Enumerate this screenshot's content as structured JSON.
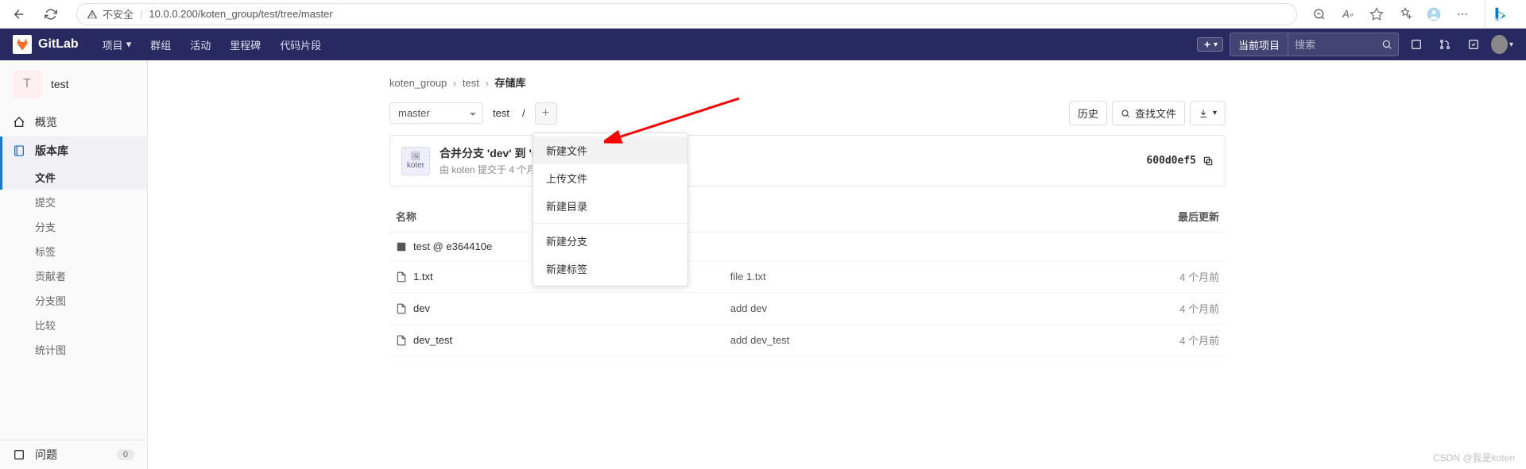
{
  "browser": {
    "insecure_label": "不安全",
    "url": "10.0.0.200/koten_group/test/tree/master"
  },
  "header": {
    "logo_text": "GitLab",
    "nav": [
      "项目",
      "群组",
      "活动",
      "里程碑",
      "代码片段"
    ],
    "search_scope": "当前项目",
    "search_placeholder": "搜索"
  },
  "sidebar": {
    "project_initial": "T",
    "project_name": "test",
    "items": [
      {
        "icon": "home",
        "label": "概览"
      },
      {
        "icon": "repo",
        "label": "版本库",
        "active": true
      }
    ],
    "repo_sub": [
      "文件",
      "提交",
      "分支",
      "标签",
      "贡献者",
      "分支图",
      "比较",
      "统计图"
    ],
    "repo_sub_active": "文件",
    "issues_label": "问题",
    "issues_count": "0"
  },
  "breadcrumb": {
    "group": "koten_group",
    "project": "test",
    "page": "存储库"
  },
  "toolbar": {
    "branch": "master",
    "path": "test",
    "history": "历史",
    "find_file": "查找文件"
  },
  "commit": {
    "avatar_alt": "koter",
    "title": "合并分支 'dev' 到 'master'",
    "meta": "由 koten 提交于 4 个月前",
    "sha": "600d0ef5"
  },
  "table": {
    "headers": [
      "名称",
      "",
      "最后更新"
    ],
    "rows": [
      {
        "icon": "submodule",
        "name": "test @ e364410e",
        "msg": "",
        "updated": ""
      },
      {
        "icon": "file",
        "name": "1.txt",
        "msg": "file 1.txt",
        "updated": "4 个月前"
      },
      {
        "icon": "file",
        "name": "dev",
        "msg": "add dev",
        "updated": "4 个月前"
      },
      {
        "icon": "file",
        "name": "dev_test",
        "msg": "add dev_test",
        "updated": "4 个月前"
      }
    ]
  },
  "dropdown": {
    "items": [
      "新建文件",
      "上传文件",
      "新建目录"
    ],
    "items2": [
      "新建分支",
      "新建标签"
    ],
    "highlighted": "新建文件"
  },
  "watermark": "CSDN @我是koten"
}
